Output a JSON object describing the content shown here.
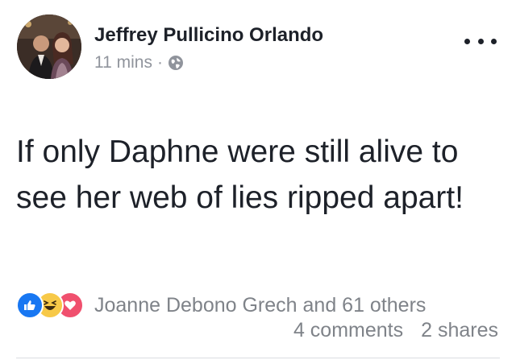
{
  "post": {
    "author_name": "Jeffrey Pullicino Orlando",
    "timestamp": "11 mins",
    "separator": "·",
    "privacy_icon": "globe-icon",
    "more_icon": "more-options-icon",
    "text": "If only Daphne were still alive to see her web of lies ripped apart!"
  },
  "engagement": {
    "reaction_icons": [
      "like-icon",
      "haha-icon",
      "love-icon"
    ],
    "reactors_text": "Joanne Debono Grech and 61 others",
    "comments": "4 comments",
    "shares": "2 shares"
  },
  "colors": {
    "like": "#1877f2",
    "haha": "#f7c948",
    "love": "#f0506e",
    "secondary_text": "#90949c"
  }
}
